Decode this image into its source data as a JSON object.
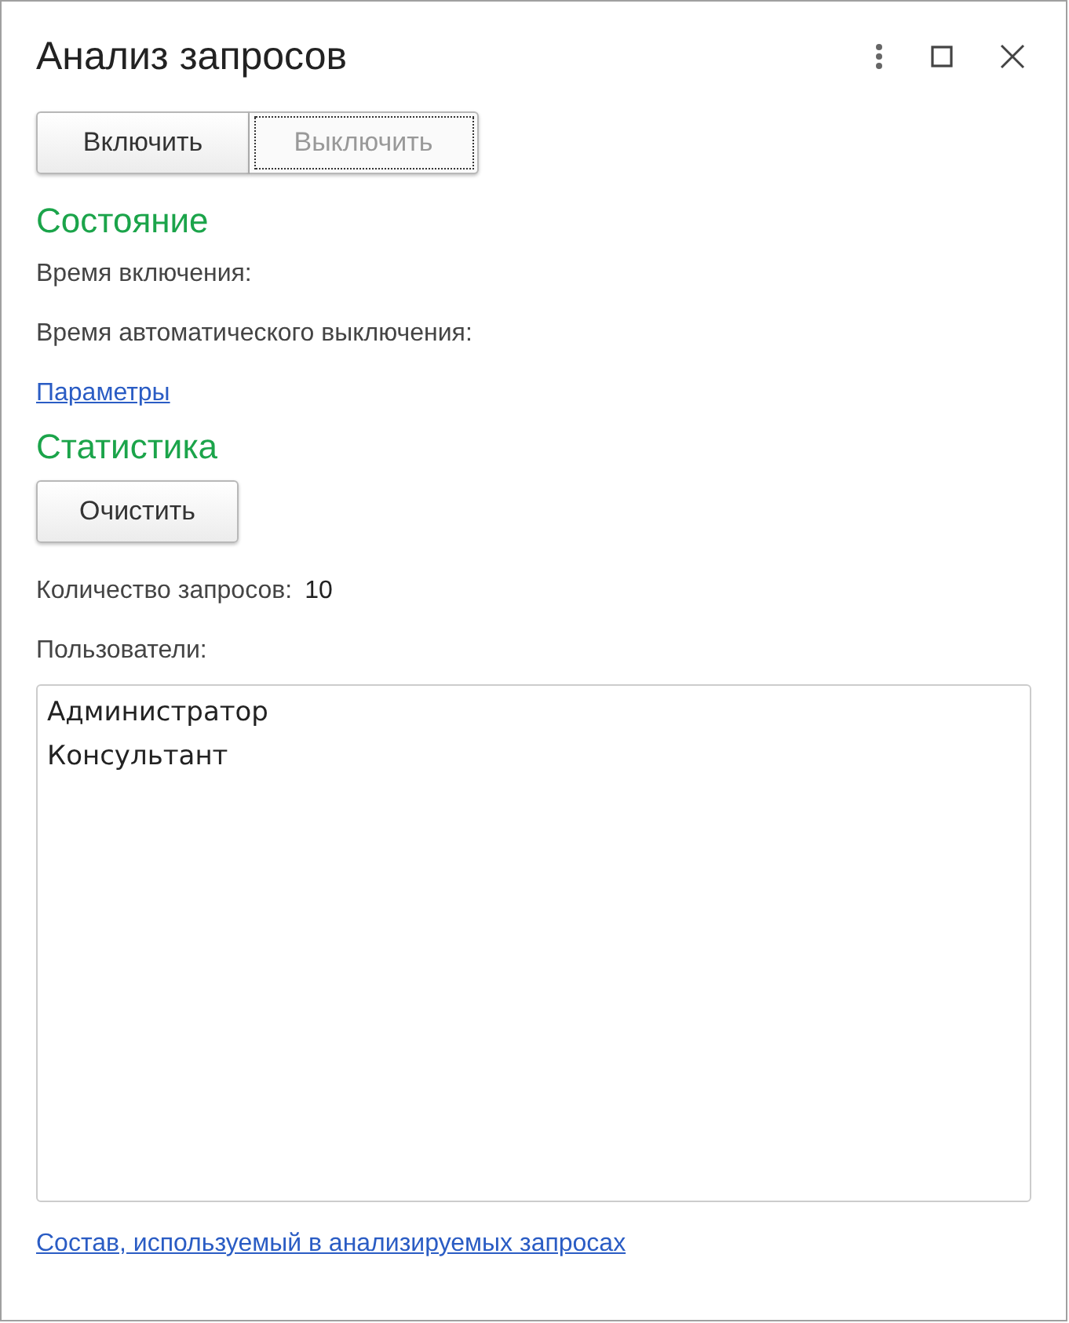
{
  "window": {
    "title": "Анализ запросов"
  },
  "toggle_buttons": [
    {
      "label": "Включить",
      "disabled": false,
      "focused": false
    },
    {
      "label": "Выключить",
      "disabled": true,
      "focused": true
    }
  ],
  "state_section": {
    "heading": "Состояние",
    "fields": [
      "Время включения:",
      "Время автоматического выключения:"
    ],
    "link": "Параметры"
  },
  "stats_section": {
    "heading": "Статистика",
    "clear_button": "Очистить",
    "count_label": "Количество запросов:",
    "count_value": "10",
    "users_label": "Пользователи:",
    "users": [
      "Администратор",
      "Консультант"
    ]
  },
  "footer_link": "Состав, используемый в анализируемых запросах"
}
